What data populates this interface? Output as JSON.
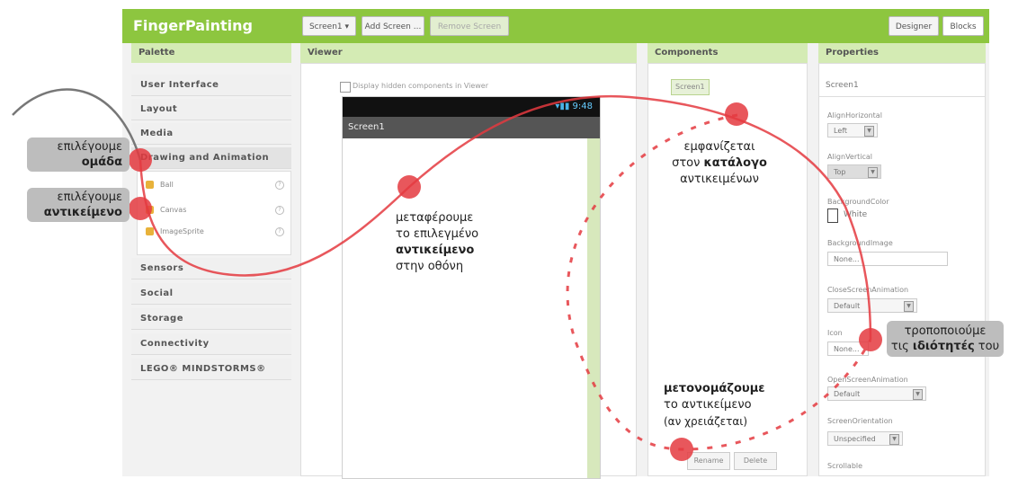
{
  "app": {
    "title": "FingerPainting",
    "screen_dropdown": "Screen1 ▾",
    "add_screen": "Add Screen ...",
    "remove_screen": "Remove Screen",
    "designer": "Designer",
    "blocks": "Blocks"
  },
  "palette": {
    "header": "Palette",
    "categories": [
      "User Interface",
      "Layout",
      "Media",
      "Drawing and Animation"
    ],
    "items": [
      "Ball",
      "Canvas",
      "ImageSprite"
    ],
    "categories_after": [
      "Sensors",
      "Social",
      "Storage",
      "Connectivity",
      "LEGO® MINDSTORMS®"
    ]
  },
  "viewer": {
    "header": "Viewer",
    "checkbox_label": "Display hidden components in Viewer",
    "status_time": "9:48",
    "screen_title": "Screen1"
  },
  "components": {
    "header": "Components",
    "root": "Screen1",
    "rename": "Rename",
    "delete": "Delete"
  },
  "properties": {
    "header": "Properties",
    "component": "Screen1",
    "fields": [
      {
        "label": "AlignHorizontal",
        "value": "Left"
      },
      {
        "label": "AlignVertical",
        "value": "Top"
      },
      {
        "label": "BackgroundColor",
        "value": "White"
      },
      {
        "label": "BackgroundImage",
        "value": "None..."
      },
      {
        "label": "CloseScreenAnimation",
        "value": "Default"
      },
      {
        "label": "Icon",
        "value": "None..."
      },
      {
        "label": "OpenScreenAnimation",
        "value": "Default"
      },
      {
        "label": "ScreenOrientation",
        "value": "Unspecified"
      },
      {
        "label": "Scrollable",
        "value": ""
      }
    ]
  },
  "annotations": {
    "select_group_l1": "επιλέγουμε",
    "select_group_l2": "ομάδα",
    "select_object_l1": "επιλέγουμε",
    "select_object_l2": "αντικείμενο",
    "move_l1": "μεταφέρουμε",
    "move_l2": "το επιλεγμένο",
    "move_l3": "αντικείμενο",
    "move_l4": "στην οθόνη",
    "appears_l1": "εμφανίζεται",
    "appears_l2a": "στον ",
    "appears_l2b": "κατάλογο",
    "appears_l3": "αντικειμένων",
    "modify_l1": "τροποποιούμε",
    "modify_l2a": "τις ",
    "modify_l2b": "ιδιότητές",
    "modify_l2c": " του",
    "rename_l1": "μετονομάζουμε",
    "rename_l2": "το αντικείμενο",
    "rename_l3": "(αν χρειάζεται)"
  },
  "colors": {
    "topbar": "#8dc63f",
    "panel_header": "#d4ebb4",
    "path": "#e4393f",
    "bubble": "#bdbdbd"
  }
}
